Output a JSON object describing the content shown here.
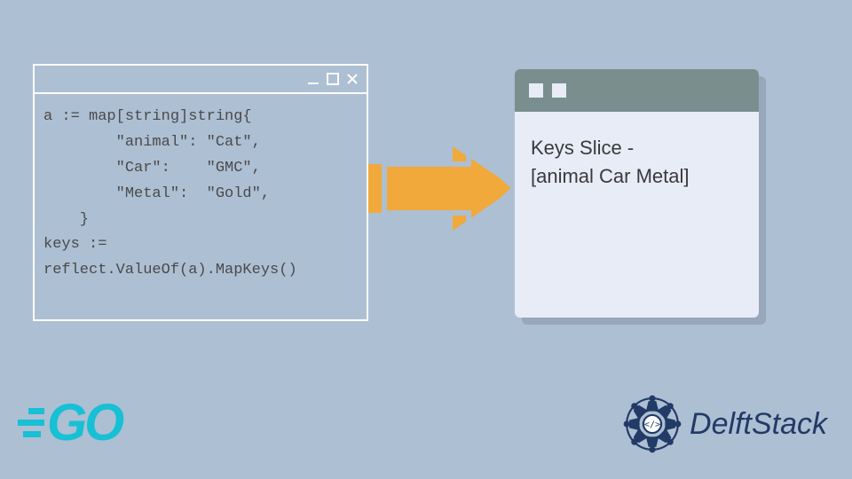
{
  "code_window": {
    "lines": [
      "a := map[string]string{",
      "        \"animal\": \"Cat\",",
      "        \"Car\":    \"GMC\",",
      "        \"Metal\":  \"Gold\",",
      "    }",
      "keys :=",
      "reflect.ValueOf(a).MapKeys()"
    ]
  },
  "result_window": {
    "line1": "Keys Slice -",
    "line2": "[animal Car Metal]"
  },
  "logos": {
    "go": "GO",
    "delft": "DelftStack"
  },
  "colors": {
    "bg": "#adbfd3",
    "arrow": "#f0a93a",
    "white": "#fdfdfd",
    "result_header": "#7a8e8e",
    "go_cyan": "#17c0d4",
    "delft_blue": "#223a66"
  }
}
